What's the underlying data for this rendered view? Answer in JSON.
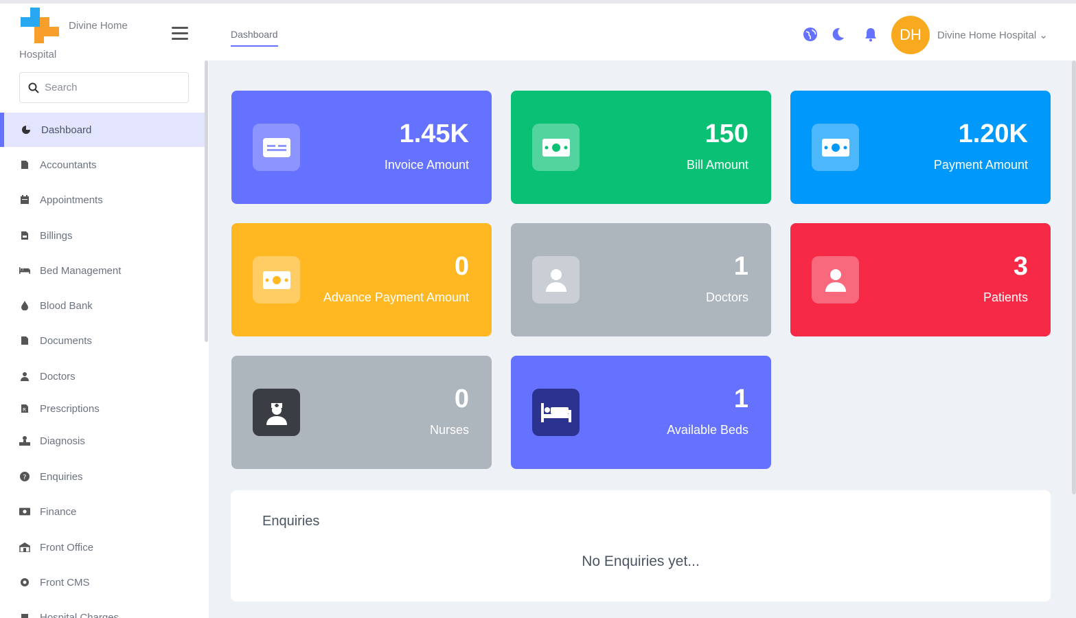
{
  "header": {
    "brand_line1": "Divine Home",
    "brand_line2": "Hospital",
    "nav_tab": "Dashboard",
    "avatar_initials": "DH",
    "user_name": "Divine Home Hospital ⌄",
    "icons": [
      "globe-icon",
      "moon-icon",
      "bell-icon",
      "menu-icon"
    ],
    "accent_color": "#6571ff"
  },
  "sidebar": {
    "search_placeholder": "Search",
    "items": [
      {
        "label": "Dashboard",
        "icon": "pie-chart-icon",
        "active": true
      },
      {
        "label": "Accountants",
        "icon": "file-icon"
      },
      {
        "label": "Appointments",
        "icon": "calendar-icon"
      },
      {
        "label": "Billings",
        "icon": "file-invoice-icon"
      },
      {
        "label": "Bed Management",
        "icon": "bed-icon"
      },
      {
        "label": "Blood Bank",
        "icon": "drop-icon"
      },
      {
        "label": "Documents",
        "icon": "document-icon"
      },
      {
        "label": "Doctors",
        "icon": "doctor-icon"
      },
      {
        "label": "Prescriptions",
        "icon": "prescription-icon"
      },
      {
        "label": "Diagnosis",
        "icon": "diagnosis-icon"
      },
      {
        "label": "Enquiries",
        "icon": "question-icon"
      },
      {
        "label": "Finance",
        "icon": "money-icon"
      },
      {
        "label": "Front Office",
        "icon": "office-icon"
      },
      {
        "label": "Front CMS",
        "icon": "cog-icon"
      },
      {
        "label": "Hospital Charges",
        "icon": "charges-icon"
      }
    ]
  },
  "cards": [
    {
      "value": "1.45K",
      "label": "Invoice Amount",
      "color": "#6571ff",
      "icon": "invoice-icon"
    },
    {
      "value": "150",
      "label": "Bill Amount",
      "color": "#0ac074",
      "icon": "money-bill-icon"
    },
    {
      "value": "1.20K",
      "label": "Payment Amount",
      "color": "#0099fb",
      "icon": "money-bill-icon"
    },
    {
      "value": "0",
      "label": "Advance Payment Amount",
      "color": "#ffb821",
      "icon": "money-bill-icon"
    },
    {
      "value": "1",
      "label": "Doctors",
      "color": "#adb5bd",
      "icon": "user-icon"
    },
    {
      "value": "3",
      "label": "Patients",
      "color": "#f62947",
      "icon": "user-icon"
    },
    {
      "value": "0",
      "label": "Nurses",
      "color": "#adb5bd",
      "icon": "nurse-icon"
    },
    {
      "value": "1",
      "label": "Available Beds",
      "color": "#6571ff",
      "icon": "bed-icon"
    }
  ],
  "enquiries": {
    "title": "Enquiries",
    "empty_message": "No Enquiries yet..."
  }
}
